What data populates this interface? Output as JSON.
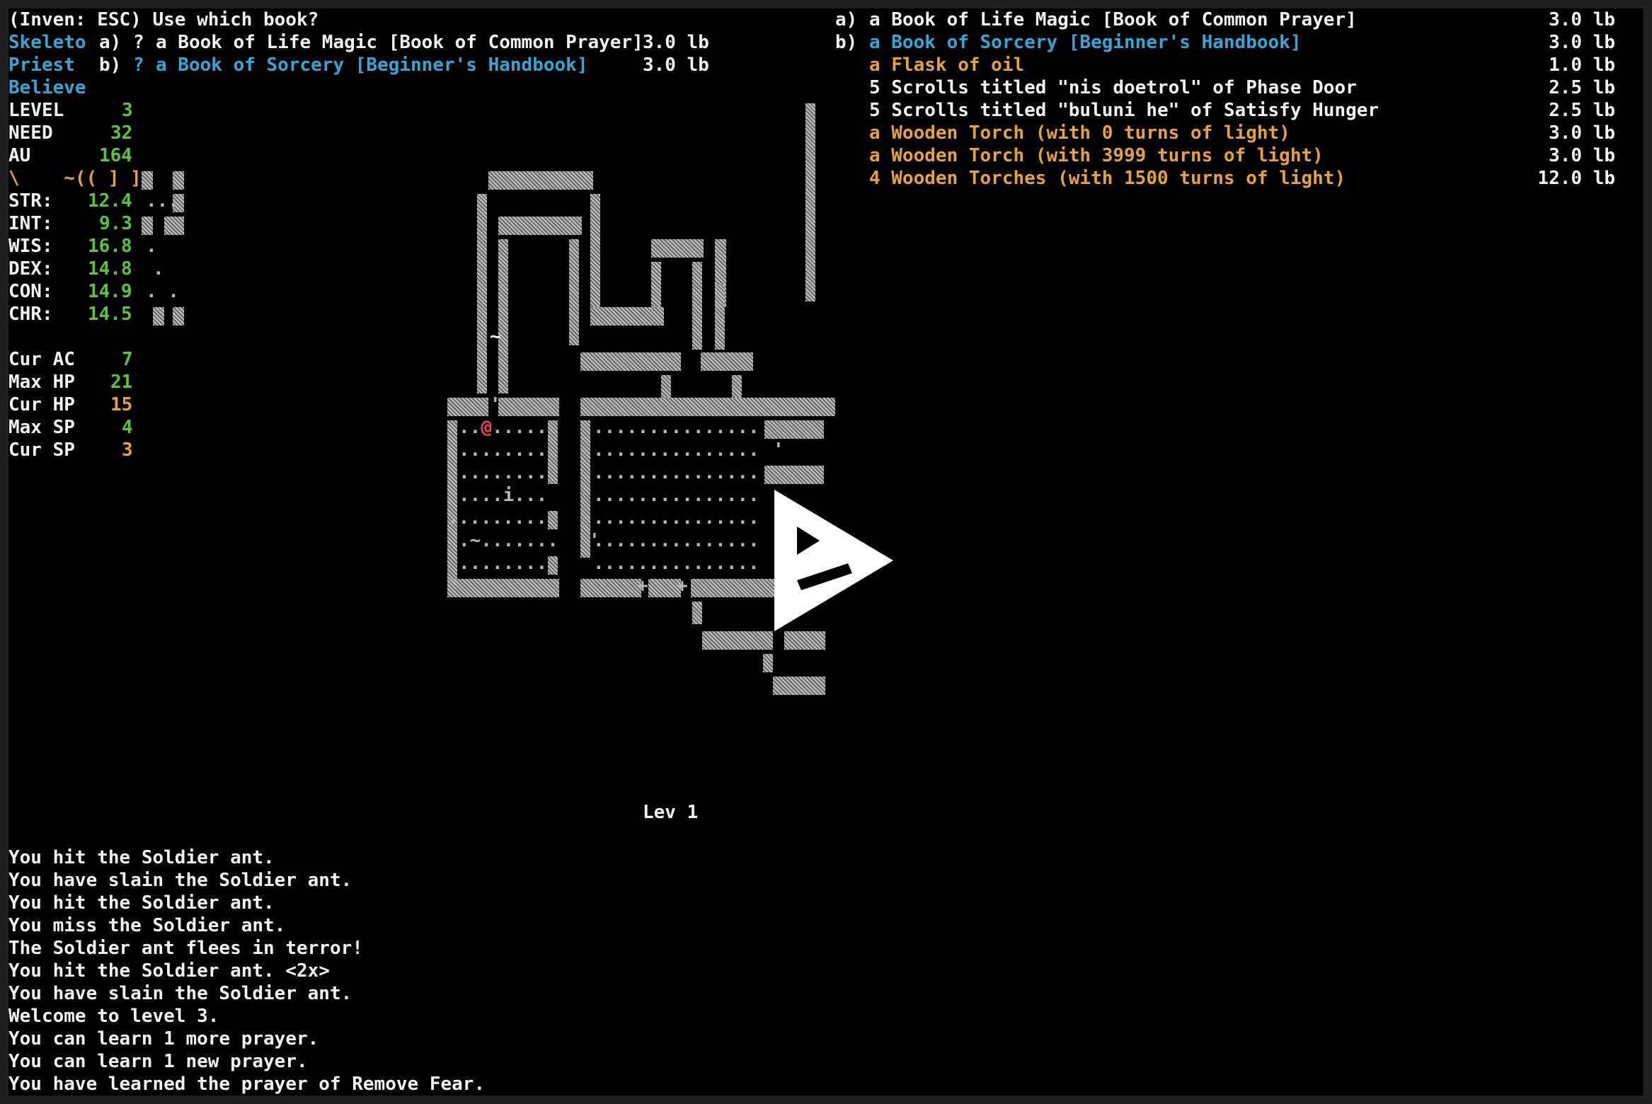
{
  "prompt": "(Inven: ESC) Use which book?",
  "char": {
    "race": "Skeleto",
    "class": "Priest",
    "title": "Believe",
    "level_label": "LEVEL",
    "level": "3",
    "need_label": "NEED",
    "need": "32",
    "au_label": "AU",
    "au": "164",
    "equip_line": "\\    ~(( ] ]",
    "stats": [
      {
        "label": "STR:",
        "value": "12.4"
      },
      {
        "label": "INT:",
        "value": "9.3"
      },
      {
        "label": "WIS:",
        "value": "16.8"
      },
      {
        "label": "DEX:",
        "value": "14.8"
      },
      {
        "label": "CON:",
        "value": "14.9"
      },
      {
        "label": "CHR:",
        "value": "14.5"
      }
    ],
    "cur_ac_label": "Cur AC",
    "cur_ac": "7",
    "max_hp_label": "Max HP",
    "max_hp": "21",
    "cur_hp_label": "Cur HP",
    "cur_hp": "15",
    "max_sp_label": "Max SP",
    "max_sp": "4",
    "cur_sp_label": "Cur SP",
    "cur_sp": "3"
  },
  "book_menu": [
    {
      "key": "a)",
      "sym": "?",
      "name": "a Book of Life Magic [Book of Common Prayer]",
      "weight": "3.0 lb"
    },
    {
      "key": "b)",
      "sym": "?",
      "name": "a Book of Sorcery [Beginner's Handbook]",
      "weight": "3.0 lb"
    }
  ],
  "inventory": [
    {
      "key": "a)",
      "name": "a Book of Life Magic [Book of Common Prayer]",
      "weight": "3.0 lb",
      "color": "#f2f2f2"
    },
    {
      "key": "b)",
      "name": "a Book of Sorcery [Beginner's Handbook]",
      "weight": "3.0 lb",
      "color": "#33a8d8"
    },
    {
      "key": "",
      "name": "a Flask of oil",
      "weight": "1.0 lb",
      "color": "#e8a23a"
    },
    {
      "key": "",
      "name": "5 Scrolls titled \"nis doetrol\" of Phase Door",
      "weight": "2.5 lb",
      "color": "#f2f2f2"
    },
    {
      "key": "",
      "name": "5 Scrolls titled \"buluni he\" of Satisfy Hunger",
      "weight": "2.5 lb",
      "color": "#f2f2f2"
    },
    {
      "key": "",
      "name": "a Wooden Torch (with 0 turns of light)",
      "weight": "3.0 lb",
      "color": "#e8a23a"
    },
    {
      "key": "",
      "name": "a Wooden Torch (with 3999 turns of light)",
      "weight": "3.0 lb",
      "color": "#e8a23a"
    },
    {
      "key": "",
      "name": "4 Wooden Torches (with 1500 turns of light)",
      "weight": "12.0 lb",
      "color": "#e8a23a"
    }
  ],
  "map": {
    "player": "@",
    "depth_label": "Lev 1"
  },
  "messages": [
    "You hit the Soldier ant.",
    "You have slain the Soldier ant.",
    "You hit the Soldier ant.",
    "You miss the Soldier ant.",
    "The Soldier ant flees in terror!",
    "You hit the Soldier ant. <2x>",
    "You have slain the Soldier ant.",
    "Welcome to level 3.",
    "You can learn 1 more prayer.",
    "You can learn 1 new prayer.",
    "You have learned the prayer of Remove Fear."
  ],
  "colors": {
    "background": "#000000",
    "text": "#f2f2f2",
    "blue": "#33a8d8",
    "green": "#5cc43a",
    "orange": "#e8a23a",
    "player": "#e8445a"
  },
  "icons": {
    "overlay": "play-logo-icon"
  }
}
